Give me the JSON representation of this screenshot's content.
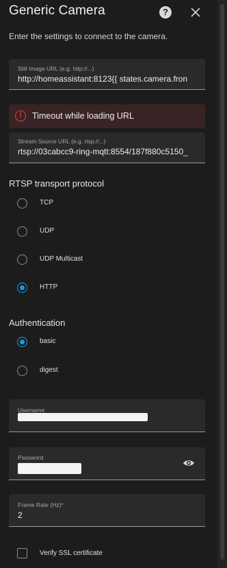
{
  "dialog": {
    "title": "Generic Camera",
    "help_icon": "question-circle-icon",
    "close_icon": "close-icon",
    "description": "Enter the settings to connect to the camera."
  },
  "still_image_url": {
    "label": "Still Image URL (e.g. http://...)",
    "value": "http://homeassistant:8123{{ states.camera.fron"
  },
  "error": {
    "icon": "alert-circle-icon",
    "message": "Timeout while loading URL",
    "color": "#e0484b"
  },
  "stream_source_url": {
    "label": "Stream Source URL (e.g. rtsp://...)",
    "value": "rtsp://03cabcc9-ring-mqtt:8554/187f880c5150_"
  },
  "rtsp_transport": {
    "title": "RTSP transport protocol",
    "options": [
      {
        "label": "TCP",
        "checked": false
      },
      {
        "label": "UDP",
        "checked": false
      },
      {
        "label": "UDP Multicast",
        "checked": false
      },
      {
        "label": "HTTP",
        "checked": true
      }
    ]
  },
  "authentication": {
    "title": "Authentication",
    "options": [
      {
        "label": "basic",
        "checked": true
      },
      {
        "label": "digest",
        "checked": false
      }
    ]
  },
  "username": {
    "label": "Username"
  },
  "password": {
    "label": "Password",
    "toggle_icon": "eye-icon"
  },
  "frame_rate": {
    "label": "Frame Rate (Hz)*",
    "value": "2"
  },
  "verify_ssl": {
    "label": "Verify SSL certificate",
    "checked": false
  },
  "colors": {
    "accent": "#0d9ee6",
    "background": "#1c1c1c",
    "field_background": "#2a2a2a"
  }
}
